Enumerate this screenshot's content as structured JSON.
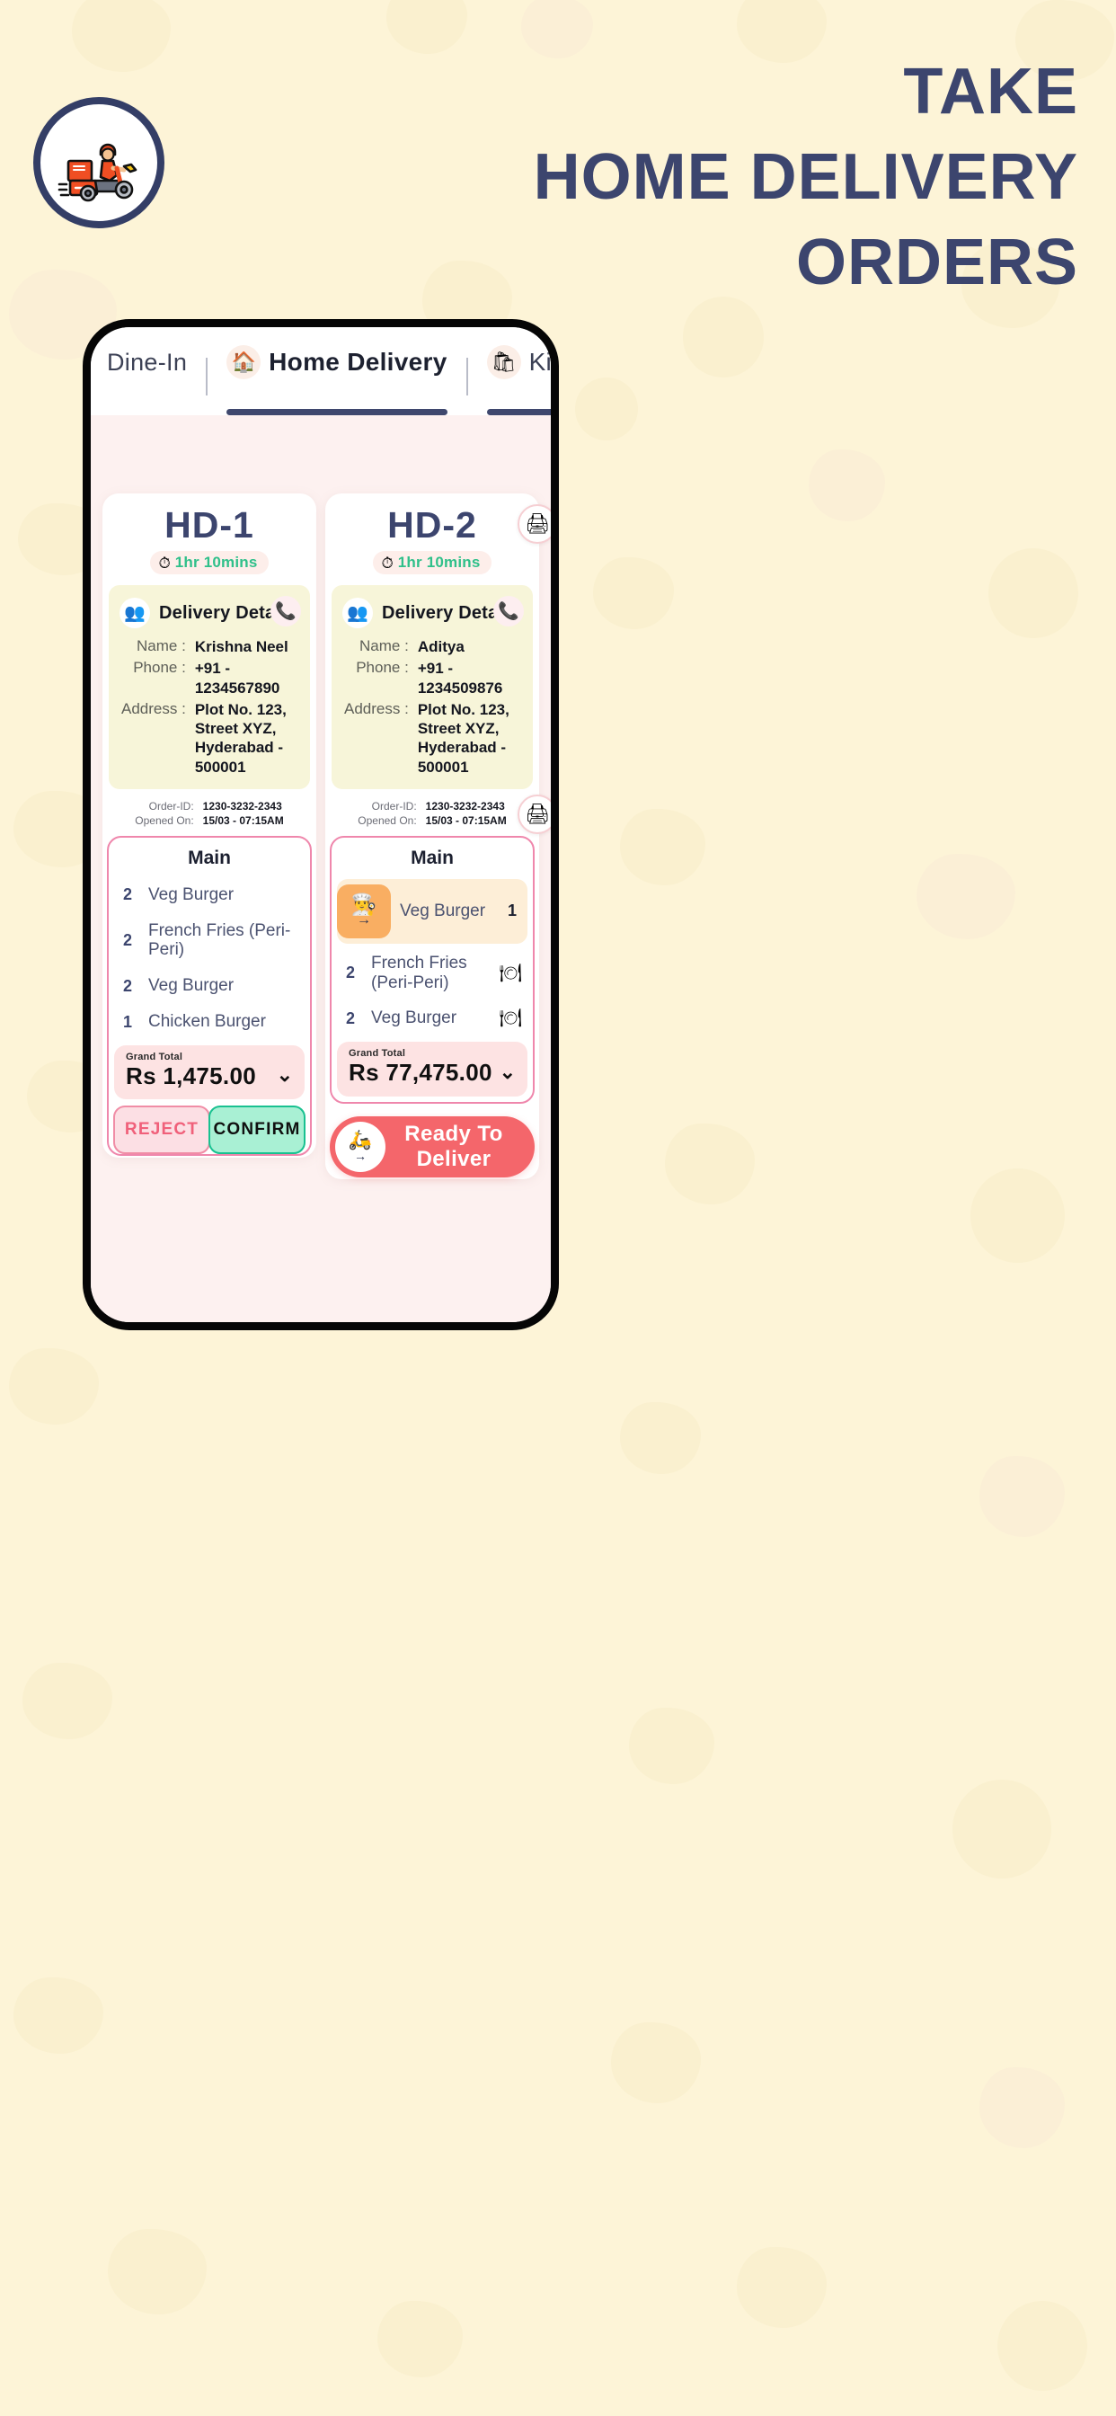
{
  "hero": {
    "headline_line1": "TAKE",
    "headline_line2": "HOME DELIVERY",
    "headline_line3": "ORDERS",
    "logo_icon": "delivery-scooter-icon",
    "headline_color": "#3c456e",
    "background_color": "#fdf4d7"
  },
  "app": {
    "tabs": [
      {
        "label": "Dine-In",
        "icon": "",
        "active": false
      },
      {
        "label": "Home Delivery",
        "icon": "house-with-pin-icon",
        "active": true
      },
      {
        "label": "Kit",
        "icon": "takeout-bag-icon",
        "active": true
      }
    ],
    "accent_colors": {
      "tab_underline": "#3f486e",
      "card_border": "#ef87ac",
      "reject": "#f0607a",
      "confirm": "#18c190",
      "ready": "#f4666b",
      "timer": "#2fc08a",
      "delivery_box": "#f7f5d9"
    },
    "orders": [
      {
        "id": "HD-1",
        "timer": "1hr 10mins",
        "timer_icon": "stopwatch-icon",
        "delivery": {
          "section_title": "Delivery Details",
          "avatar_icon": "people-icon",
          "phone_icon": "phone-ring-icon",
          "name_label": "Name :",
          "name_value": "Krishna Neel",
          "phone_label": "Phone :",
          "phone_value": "+91 - 1234567890",
          "address_label": "Address :",
          "address_value": "Plot No. 123, Street XYZ, Hyderabad - 500001"
        },
        "meta": {
          "order_id_label": "Order-ID:",
          "order_id_value": "1230-3232-2343",
          "opened_label": "Opened On:",
          "opened_value": "15/03 - 07:15AM"
        },
        "has_print_button": false,
        "items_title": "Main",
        "items": [
          {
            "qty": "2",
            "name": "Veg Burger",
            "state": "plain"
          },
          {
            "qty": "2",
            "name": "French Fries (Peri-Peri)",
            "state": "plain"
          },
          {
            "qty": "2",
            "name": "Veg Burger",
            "state": "plain"
          },
          {
            "qty": "1",
            "name": "Chicken Burger",
            "state": "plain"
          }
        ],
        "grand_total_label": "Grand Total",
        "grand_total_value": "Rs 1,475.00",
        "chevron": "⌄",
        "actions": [
          {
            "label": "REJECT",
            "kind": "reject"
          },
          {
            "label": "CONFIRM",
            "kind": "confirm"
          }
        ]
      },
      {
        "id": "HD-2",
        "timer": "1hr 10mins",
        "timer_icon": "stopwatch-icon",
        "print_icon": "printer-icon",
        "has_print_button": true,
        "delivery": {
          "section_title": "Delivery Details",
          "avatar_icon": "people-icon",
          "phone_icon": "phone-ring-icon",
          "name_label": "Name :",
          "name_value": "Aditya",
          "phone_label": "Phone :",
          "phone_value": "+91 - 1234509876",
          "address_label": "Address :",
          "address_value": "Plot No. 123, Street XYZ, Hyderabad - 500001"
        },
        "meta": {
          "order_id_label": "Order-ID:",
          "order_id_value": "1230-3232-2343",
          "opened_label": "Opened On:",
          "opened_value": "15/03 - 07:15AM"
        },
        "items_title": "Main",
        "items": [
          {
            "qty": "1",
            "name": "Veg Burger",
            "state": "cooking",
            "chip_icon": "chef-cooking-icon",
            "chip_arrow": "→"
          },
          {
            "qty": "2",
            "name": "French Fries (Peri-Peri)",
            "state": "ready",
            "bell_icon": "cloche-icon"
          },
          {
            "qty": "2",
            "name": "Veg Burger",
            "state": "ready",
            "bell_icon": "cloche-icon"
          }
        ],
        "grand_total_label": "Grand Total",
        "grand_total_value": "Rs 77,475.00",
        "chevron": "⌄",
        "ready_button": {
          "label": "Ready To Deliver",
          "icon": "scooter-delivery-icon",
          "arrow": "→"
        }
      }
    ]
  }
}
